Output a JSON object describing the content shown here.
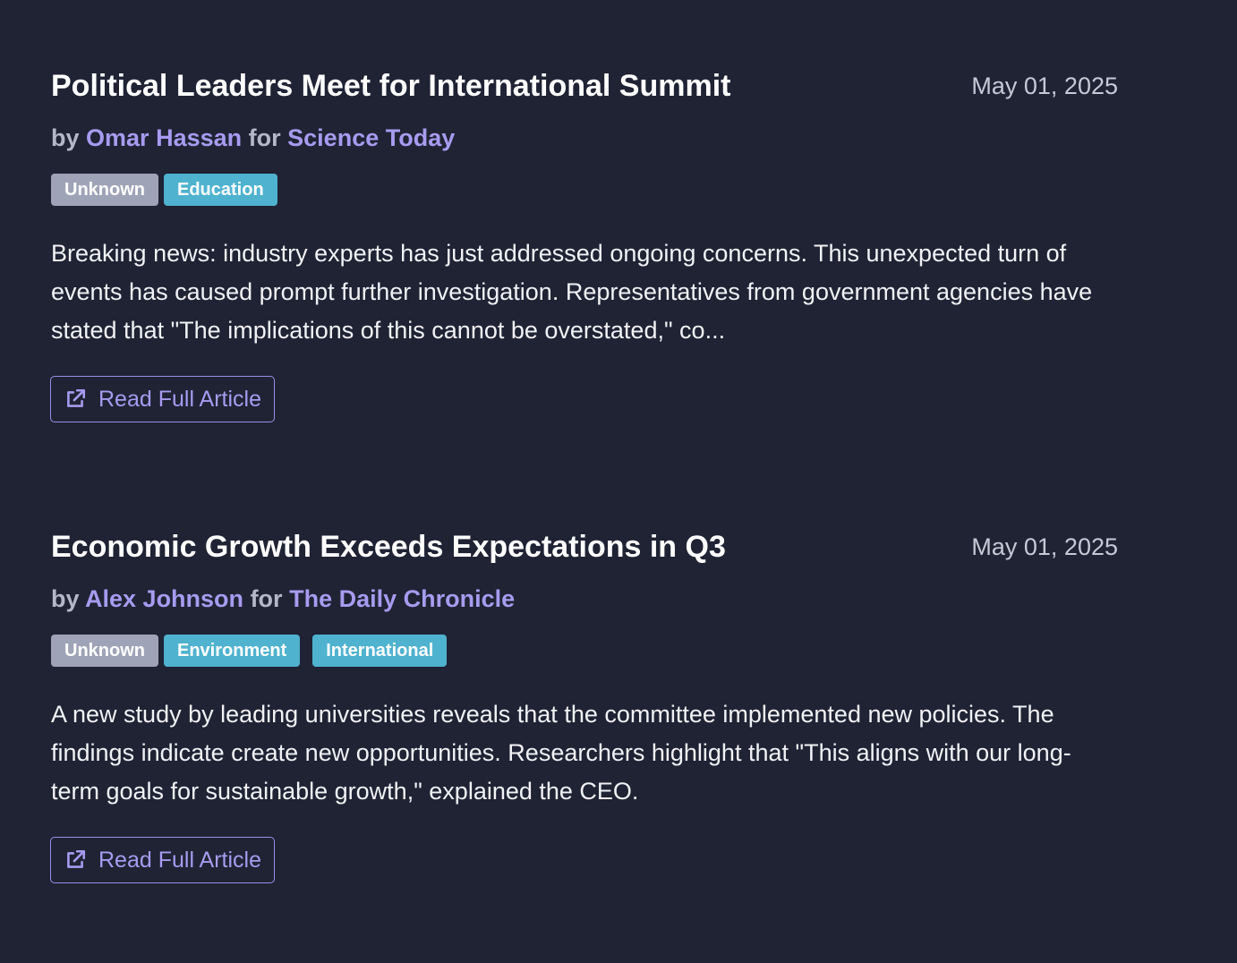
{
  "articles": [
    {
      "title": "Political Leaders Meet for International Summit",
      "date": "May 01, 2025",
      "by_prefix": "by",
      "author": "Omar Hassan",
      "for_word": "for",
      "publication": "Science Today",
      "tags": [
        "Unknown",
        "Education"
      ],
      "summary": "Breaking news: industry experts has just addressed ongoing concerns. This unexpected turn of events has caused prompt further investigation. Representatives from government agencies have stated that \"The implications of this cannot be overstated,\" co...",
      "button_label": "Read Full Article",
      "button_icon": "external-link-icon"
    },
    {
      "title": "Economic Growth Exceeds Expectations in Q3",
      "date": "May 01, 2025",
      "by_prefix": "by",
      "author": "Alex Johnson",
      "for_word": "for",
      "publication": "The Daily Chronicle",
      "tags": [
        "Unknown",
        "Environment",
        "International"
      ],
      "summary": "A new study by leading universities reveals that the committee implemented new policies. The findings indicate create new opportunities. Researchers highlight that \"This aligns with our long-term goals for sustainable growth,\" explained the CEO.",
      "button_label": "Read Full Article",
      "button_icon": "external-link-icon"
    }
  ],
  "colors": {
    "background": "#1f2334",
    "accent": "#a79bf0",
    "tag_gray": "#9fa3b7",
    "tag_blue": "#4fb2cf"
  }
}
